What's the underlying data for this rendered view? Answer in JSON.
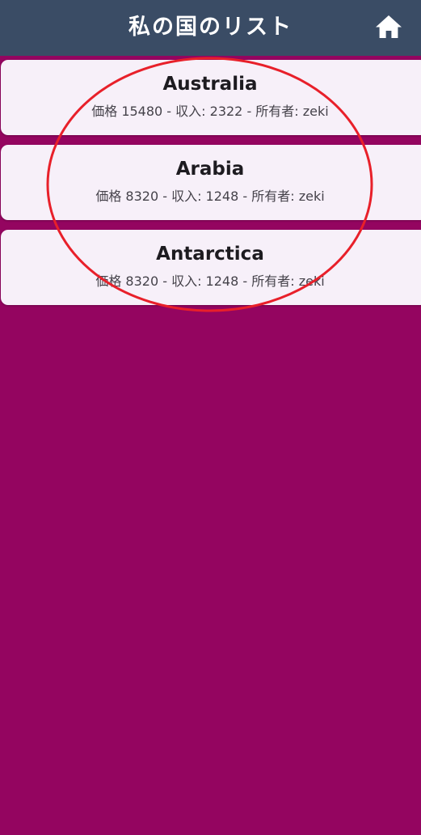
{
  "appbar": {
    "title": "私の国のリスト",
    "home_icon": "home-icon",
    "background_color": "#3a4c65"
  },
  "background_color": "#940560",
  "countries": [
    {
      "name": "Australia",
      "details": "価格 15480 - 収入: 2322 - 所有者: zeki"
    },
    {
      "name": "Arabia",
      "details": "価格 8320 - 収入: 1248 - 所有者: zeki"
    },
    {
      "name": "Antarctica",
      "details": "価格 8320 - 収入: 1248 - 所有者: zeki"
    }
  ],
  "annotation": {
    "shape": "ellipse",
    "color": "#e8202a"
  }
}
